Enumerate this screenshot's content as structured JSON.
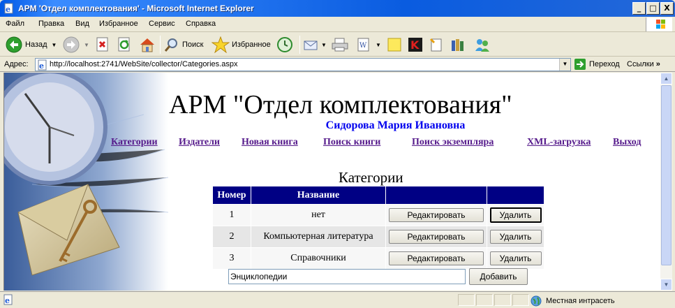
{
  "window": {
    "title": "АРМ 'Отдел комплектования' - Microsoft Internet Explorer",
    "minimize": "_",
    "maximize": "□",
    "close": "X"
  },
  "menu": [
    "Файл",
    "Правка",
    "Вид",
    "Избранное",
    "Сервис",
    "Справка"
  ],
  "toolbar": {
    "back_label": "Назад",
    "search_label": "Поиск",
    "favorites_label": "Избранное"
  },
  "address": {
    "label": "Адрес:",
    "url": "http://localhost:2741/WebSite/collector/Categories.aspx",
    "go_label": "Переход",
    "links_label": "Ссылки"
  },
  "page": {
    "heading": "АРМ \"Отдел комплектования\"",
    "user": "Сидорова Мария Ивановна",
    "nav": [
      "Категории",
      "Издатели",
      "Новая книга",
      "Поиск книги",
      "Поиск экземпляра",
      "XML-загрузка",
      "Выход"
    ],
    "section_title": "Категории",
    "table": {
      "headers": [
        "Номер",
        "Название",
        "",
        ""
      ],
      "rows": [
        {
          "num": "1",
          "name": "нет",
          "edit": "Редактировать",
          "delete": "Удалить"
        },
        {
          "num": "2",
          "name": "Компьютерная литература",
          "edit": "Редактировать",
          "delete": "Удалить"
        },
        {
          "num": "3",
          "name": "Справочники",
          "edit": "Редактировать",
          "delete": "Удалить"
        }
      ]
    },
    "new_category_value": "Энциклопедии",
    "add_button": "Добавить"
  },
  "status": {
    "zone": "Местная интрасеть"
  },
  "colors": {
    "grid_header": "#000084",
    "nav_link": "#551a8b",
    "user_name": "#0000ee"
  }
}
